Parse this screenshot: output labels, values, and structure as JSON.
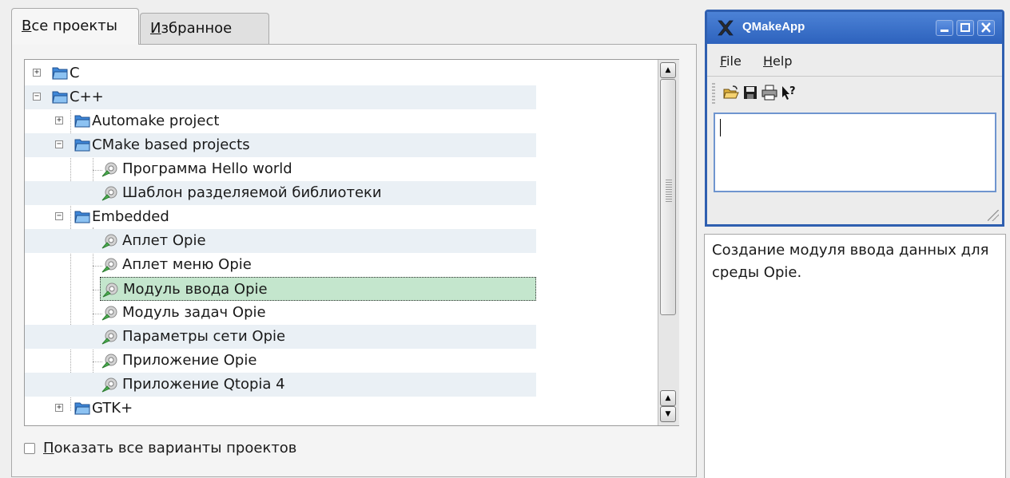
{
  "tabs": [
    {
      "pre": "",
      "ul": "В",
      "post": "се проекты",
      "active": true
    },
    {
      "pre": "",
      "ul": "И",
      "post": "збранное",
      "active": false
    }
  ],
  "tree": [
    {
      "label": "C",
      "kind": "folder",
      "level": 0,
      "expander": "plus"
    },
    {
      "label": "C++",
      "kind": "folder",
      "level": 0,
      "expander": "minus"
    },
    {
      "label": "Automake project",
      "kind": "folder",
      "level": 1,
      "expander": "plus"
    },
    {
      "label": "CMake based projects",
      "kind": "folder",
      "level": 1,
      "expander": "minus"
    },
    {
      "label": "Программа Hello world",
      "kind": "template",
      "level": 2
    },
    {
      "label": "Шаблон разделяемой библиотеки",
      "kind": "template",
      "level": 2
    },
    {
      "label": "Embedded",
      "kind": "folder",
      "level": 1,
      "expander": "minus"
    },
    {
      "label": "Аплет Opie",
      "kind": "template",
      "level": 2
    },
    {
      "label": "Аплет меню Opie",
      "kind": "template",
      "level": 2
    },
    {
      "label": "Модуль ввода Opie",
      "kind": "template",
      "level": 2,
      "selected": true
    },
    {
      "label": "Модуль задач Opie",
      "kind": "template",
      "level": 2
    },
    {
      "label": "Параметры сети Opie",
      "kind": "template",
      "level": 2
    },
    {
      "label": "Приложение Opie",
      "kind": "template",
      "level": 2
    },
    {
      "label": "Приложение Qtopia 4",
      "kind": "template",
      "level": 2
    },
    {
      "label": "GTK+",
      "kind": "folder",
      "level": 1,
      "expander": "plus"
    }
  ],
  "show_all": {
    "pre": "",
    "ul": "П",
    "post": "оказать все варианты проектов",
    "checked": false
  },
  "preview": {
    "title": "QMakeApp",
    "menus": [
      {
        "ul": "F",
        "post": "ile"
      },
      {
        "ul": "H",
        "post": "elp"
      }
    ],
    "tools": [
      "open-icon",
      "save-icon",
      "print-icon",
      "whats-this-icon"
    ]
  },
  "description": "Создание модуля ввода данных для среды Opie.",
  "colors": {
    "selection": "#c4e6cd",
    "alt_row": "#eaf0f5",
    "titlebar": "#2d62bd"
  }
}
